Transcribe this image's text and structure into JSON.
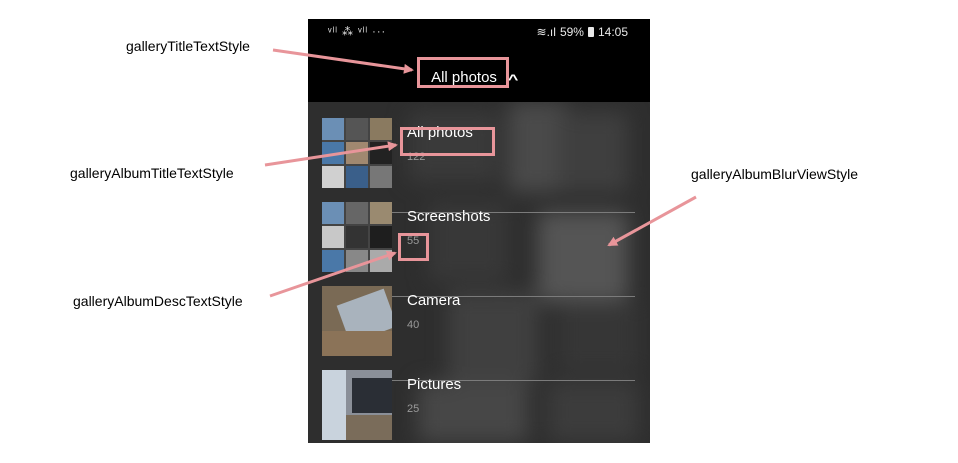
{
  "status_bar": {
    "left_icons": "ᵛˡˡ ⁂ ᵛˡˡ ···",
    "battery_percent": "59%",
    "time": "14:05"
  },
  "header": {
    "title": "All photos",
    "chevron_icon": "chevron-up-icon"
  },
  "albums": [
    {
      "title": "All photos",
      "count": "122"
    },
    {
      "title": "Screenshots",
      "count": "55"
    },
    {
      "title": "Camera",
      "count": "40"
    },
    {
      "title": "Pictures",
      "count": "25"
    }
  ],
  "callouts": {
    "title_style": "galleryTitleTextStyle",
    "album_title_style": "galleryAlbumTitleTextStyle",
    "blur_view_style": "galleryAlbumBlurViewStyle",
    "album_desc_style": "galleryAlbumDescTextStyle"
  },
  "colors": {
    "highlight": "#e8959a",
    "panel": "#2e2e2e",
    "header": "#000000"
  }
}
